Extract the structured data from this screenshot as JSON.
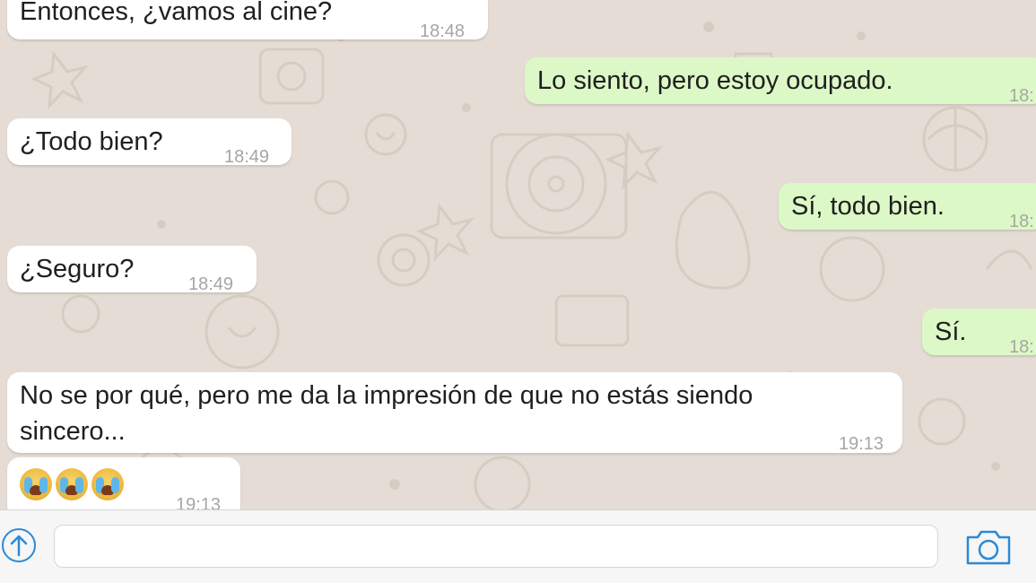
{
  "messages": [
    {
      "id": "m1",
      "direction": "incoming",
      "text": "Entonces, ¿vamos al cine?",
      "time": "18:48"
    },
    {
      "id": "m2",
      "direction": "outgoing",
      "text": "Lo siento, pero estoy ocupado.",
      "time": "18:"
    },
    {
      "id": "m3",
      "direction": "incoming",
      "text": "¿Todo bien?",
      "time": "18:49"
    },
    {
      "id": "m4",
      "direction": "outgoing",
      "text": "Sí, todo bien.",
      "time": "18:"
    },
    {
      "id": "m5",
      "direction": "incoming",
      "text": "¿Seguro?",
      "time": "18:49"
    },
    {
      "id": "m6",
      "direction": "outgoing",
      "text": "Sí.",
      "time": "18:"
    },
    {
      "id": "m7",
      "direction": "incoming",
      "line1": "No se por qué, pero me da la impresión de que no estás siendo",
      "line2": "sincero...",
      "time": "19:13"
    },
    {
      "id": "m8",
      "direction": "incoming",
      "emoji": [
        "loudly-crying-face",
        "loudly-crying-face",
        "loudly-crying-face"
      ],
      "time": "19:13"
    }
  ],
  "composer": {
    "placeholder": "",
    "attach_icon": "arrow-up-circle-icon",
    "camera_icon": "camera-icon"
  },
  "colors": {
    "chat_background": "#e5ddd5",
    "incoming_bubble": "#ffffff",
    "outgoing_bubble": "#dcf8c6",
    "accent": "#2a8ad8"
  }
}
